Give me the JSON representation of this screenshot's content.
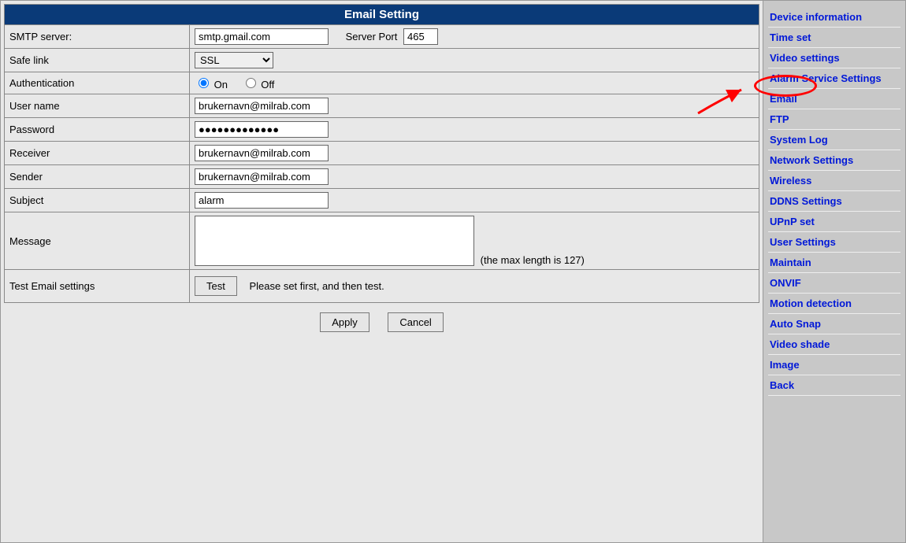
{
  "header": {
    "title": "Email Setting"
  },
  "form": {
    "smtp": {
      "label": "SMTP server:",
      "value": "smtp.gmail.com",
      "port_label": "Server Port",
      "port_value": "465"
    },
    "safe_link": {
      "label": "Safe link",
      "value": "SSL"
    },
    "auth": {
      "label": "Authentication",
      "on_label": "On",
      "off_label": "Off"
    },
    "username": {
      "label": "User name",
      "value": "brukernavn@milrab.com"
    },
    "password": {
      "label": "Password",
      "value": "●●●●●●●●●●●●●"
    },
    "receiver": {
      "label": "Receiver",
      "value": "brukernavn@milrab.com"
    },
    "sender": {
      "label": "Sender",
      "value": "brukernavn@milrab.com"
    },
    "subject": {
      "label": "Subject",
      "value": "alarm"
    },
    "message": {
      "label": "Message",
      "value": "",
      "note": "(the max length is 127)"
    },
    "test": {
      "label": "Test Email settings",
      "button": "Test",
      "hint": "Please set first, and then test."
    }
  },
  "buttons": {
    "apply": "Apply",
    "cancel": "Cancel"
  },
  "sidebar": {
    "items": [
      "Device information",
      "Time set",
      "Video settings",
      "Alarm Service Settings",
      "Email",
      "FTP",
      "System Log",
      "Network Settings",
      "Wireless",
      "DDNS Settings",
      "UPnP set",
      "User Settings",
      "Maintain",
      "ONVIF",
      "Motion detection",
      "Auto Snap",
      "Video shade",
      "Image",
      "Back"
    ]
  }
}
